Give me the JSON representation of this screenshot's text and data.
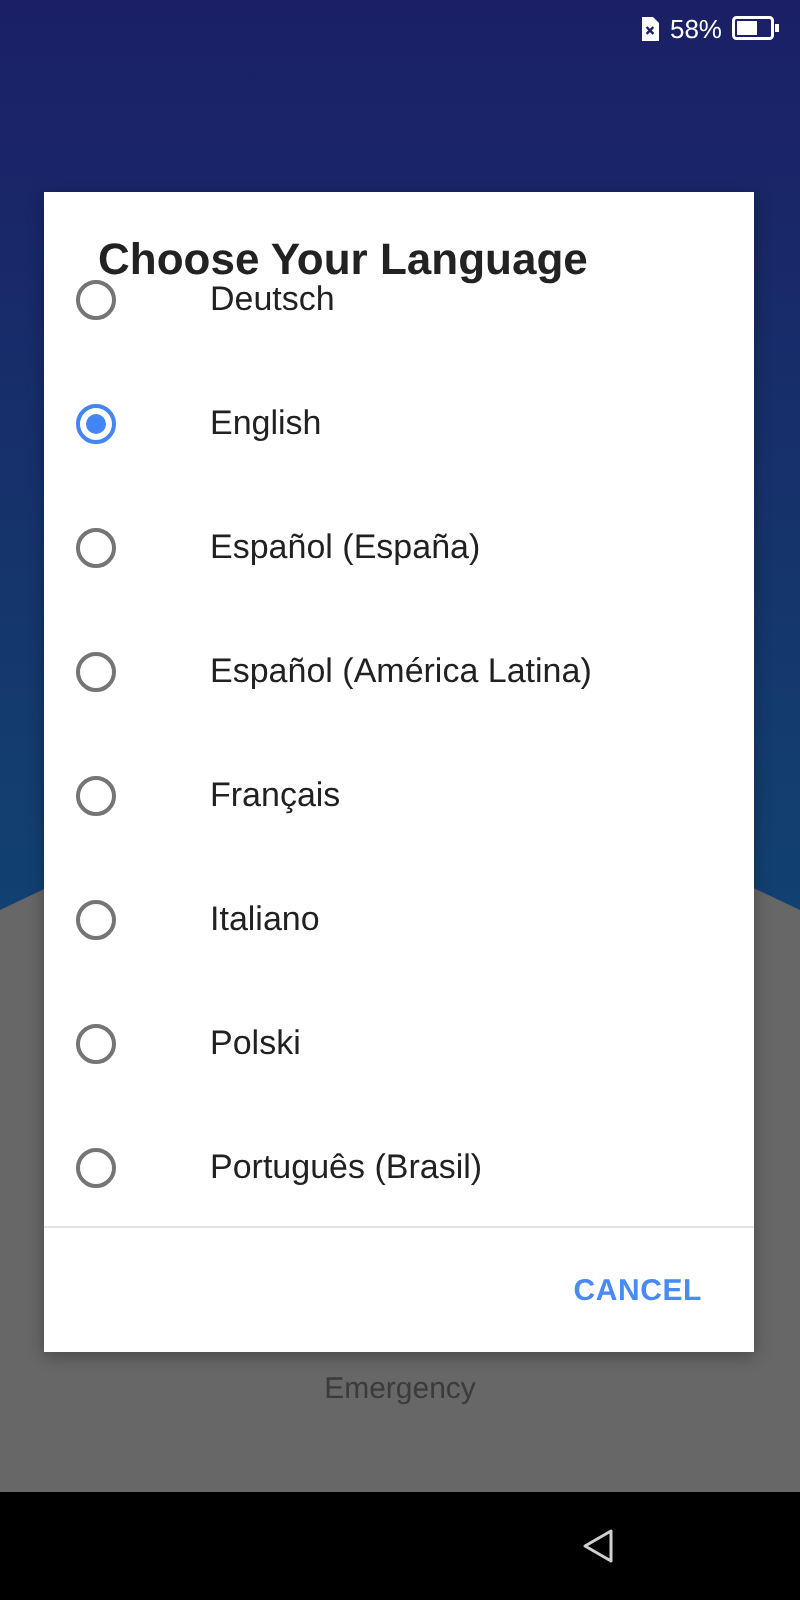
{
  "status_bar": {
    "battery": "58%"
  },
  "dialog": {
    "title": "Choose Your Language",
    "languages": [
      {
        "label": "Deutsch",
        "selected": false
      },
      {
        "label": "English",
        "selected": true
      },
      {
        "label": "Español (España)",
        "selected": false
      },
      {
        "label": "Español (América Latina)",
        "selected": false
      },
      {
        "label": "Français",
        "selected": false
      },
      {
        "label": "Italiano",
        "selected": false
      },
      {
        "label": "Polski",
        "selected": false
      },
      {
        "label": "Português (Brasil)",
        "selected": false
      }
    ],
    "cancel": "CANCEL"
  },
  "emergency": "Emergency"
}
